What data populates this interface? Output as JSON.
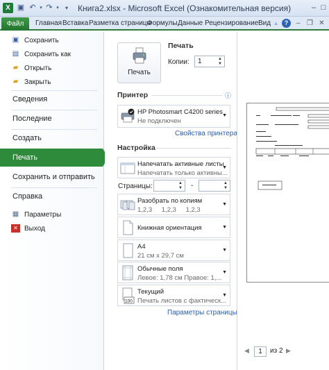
{
  "titlebar": {
    "app_badge": "X",
    "title": "Книга2.xlsx - Microsoft Excel (Ознакомительная версия)"
  },
  "ribbon": {
    "file_tab": "Файл",
    "tabs": [
      "Главная",
      "Вставка",
      "Разметка страницы",
      "Формулы",
      "Данные",
      "Рецензирование",
      "Вид"
    ],
    "help_glyph": "?"
  },
  "nav": {
    "commands": [
      {
        "label": "Сохранить",
        "icon": "save-icon"
      },
      {
        "label": "Сохранить как",
        "icon": "save-as-icon"
      },
      {
        "label": "Открыть",
        "icon": "open-folder-icon"
      },
      {
        "label": "Закрыть",
        "icon": "close-folder-icon"
      }
    ],
    "sections": [
      "Сведения",
      "Последние",
      "Создать",
      "Печать",
      "Сохранить и отправить",
      "Справка"
    ],
    "active": "Печать",
    "bottom": [
      {
        "label": "Параметры",
        "icon": "options-icon"
      },
      {
        "label": "Выход",
        "icon": "exit-icon"
      }
    ]
  },
  "print": {
    "heading": "Печать",
    "button_label": "Печать",
    "copies_label": "Копии:",
    "copies_value": "1"
  },
  "printer": {
    "heading": "Принтер",
    "name": "HP Photosmart C4200 series",
    "status": "Не подключен",
    "properties_link": "Свойства принтера"
  },
  "settings": {
    "heading": "Настройка",
    "scope": {
      "title": "Напечатать активные листы",
      "subtitle": "Напечатать только активны..."
    },
    "pages_label": "Страницы:",
    "pages_dash": "-",
    "collate": {
      "title": "Разобрать по копиям",
      "pattern": [
        "1,2,3",
        "1,2,3",
        "1,2,3"
      ]
    },
    "orientation": {
      "title": "Книжная ориентация"
    },
    "paper": {
      "title": "A4",
      "subtitle": "21 см x 29,7 см"
    },
    "margins": {
      "title": "Обычные поля",
      "subtitle": "Левое: 1,78 см    Правое: 1,..."
    },
    "scaling": {
      "title": "Текущий",
      "subtitle": "Печать листов с фактическ..."
    },
    "page_setup_link": "Параметры страницы"
  },
  "preview": {
    "page_current": "1",
    "page_total": "из 2"
  },
  "colors": {
    "accent_green": "#2f8b3c",
    "link_blue": "#2a5db0"
  }
}
